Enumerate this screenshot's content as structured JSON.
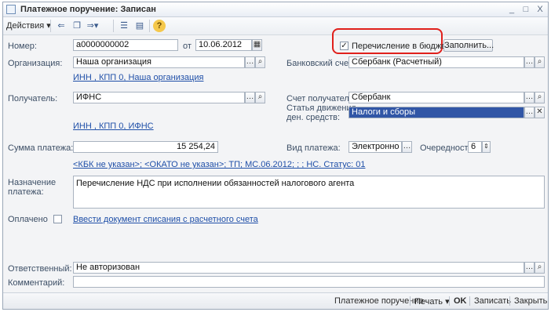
{
  "window": {
    "title": "Платежное поручение: Записан",
    "minimize": "_",
    "maximize": "□",
    "close": "X"
  },
  "toolbar": {
    "actions_label": "Действия"
  },
  "form": {
    "number_label": "Номер:",
    "number_value": "а0000000002",
    "date_prefix": "от",
    "date_value": "10.06.2012",
    "budget_checkbox_label": "Перечисление в бюджет",
    "budget_checked": "✓",
    "fill_button": "Заполнить...",
    "org_label": "Организация:",
    "org_value": "Наша организация",
    "org_link": "ИНН , КПП 0, Наша организация",
    "bank_account_label": "Банковский счет:",
    "bank_account_value": "Сбербанк (Расчетный)",
    "recipient_label": "Получатель:",
    "recipient_value": "ИФНС",
    "recipient_link": "ИНН , КПП 0, ИФНС",
    "recipient_account_label": "Счет получателя:",
    "recipient_account_value": "Сбербанк",
    "cashflow_label_line1": "Статья движения",
    "cashflow_label_line2": "ден. средств:",
    "cashflow_value": "Налоги и сборы",
    "amount_label": "Сумма платежа:",
    "amount_value": "15 254,24",
    "payment_type_label": "Вид платежа:",
    "payment_type_value": "Электронно",
    "priority_label": "Очередность:",
    "priority_value": "6",
    "budget_link": "<КБК не указан>; <ОКАТО не указан>; ТП; МС.06.2012; ; ; НС. Статус: 01",
    "purpose_label_line1": "Назначение",
    "purpose_label_line2": "платежа:",
    "purpose_value": "Перечисление НДС при исполнении обязанностей налогового агента",
    "paid_label": "Оплачено",
    "writeoff_link": "Ввести документ списания с расчетного счета",
    "responsible_label": "Ответственный:",
    "responsible_value": "Не авторизован",
    "comment_label": "Комментарий:",
    "comment_value": ""
  },
  "bottom_bar": {
    "print_form": "Платежное поручение",
    "print": "Печать",
    "ok": "OK",
    "save": "Записать",
    "close": "Закрыть"
  },
  "icons": [
    "document-icon",
    "back-icon",
    "copy-icon",
    "forward-icon",
    "list-icon",
    "structure-icon",
    "help-icon",
    "calendar-icon",
    "search-icon",
    "clear-icon",
    "spin-icon"
  ],
  "colors": {
    "accent_selection": "#3156a6",
    "link": "#1f4fa8",
    "highlight_circle": "#e0201c"
  }
}
